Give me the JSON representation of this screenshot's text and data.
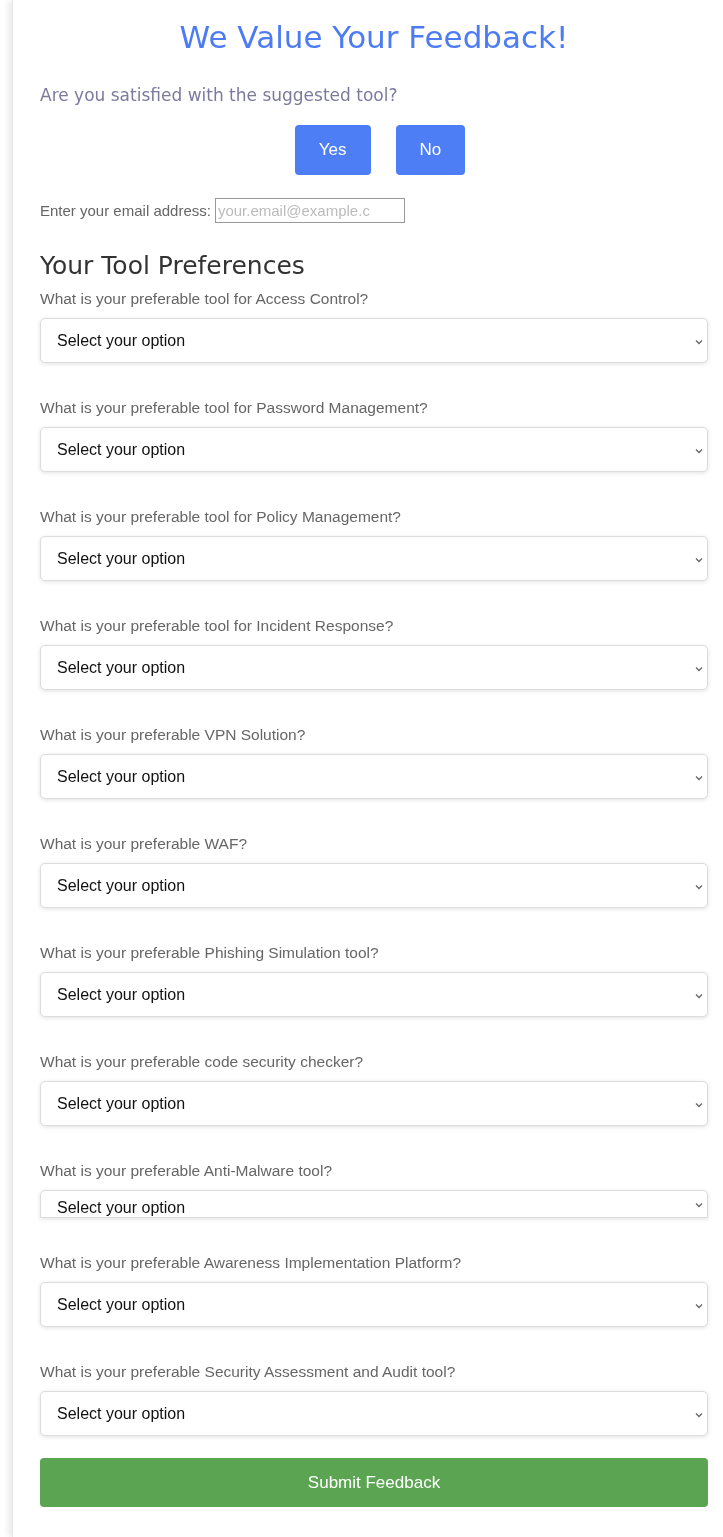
{
  "title": "We Value Your Feedback!",
  "satisfaction": {
    "question": "Are you satisfied with the suggested tool?",
    "buttons": [
      "Yes",
      "No"
    ]
  },
  "email": {
    "label": "Enter your email address:",
    "placeholder": "your.email@example.c"
  },
  "preferences": {
    "heading": "Your Tool Preferences",
    "questions": [
      {
        "label": "What is your preferable tool for Access Control?",
        "value": "Select your option",
        "clipped": false
      },
      {
        "label": "What is your preferable tool for Password Management?",
        "value": "Select your option",
        "clipped": false
      },
      {
        "label": "What is your preferable tool for Policy Management?",
        "value": "Select your option",
        "clipped": false
      },
      {
        "label": "What is your preferable tool for Incident Response?",
        "value": "Select your option",
        "clipped": false
      },
      {
        "label": "What is your preferable VPN Solution?",
        "value": "Select your option",
        "clipped": false
      },
      {
        "label": "What is your preferable WAF?",
        "value": "Select your option",
        "clipped": false
      },
      {
        "label": "What is your preferable Phishing Simulation tool?",
        "value": "Select your option",
        "clipped": false
      },
      {
        "label": "What is your preferable code security checker?",
        "value": "Select your option",
        "clipped": false
      },
      {
        "label": "What is your preferable Anti-Malware tool?",
        "value": "Select your option",
        "clipped": true
      },
      {
        "label": "What is your preferable Awareness Implementation Platform?",
        "value": "Select your option",
        "clipped": false
      },
      {
        "label": "What is your preferable Security Assessment and Audit tool?",
        "value": "Select your option",
        "clipped": false
      }
    ]
  },
  "submit": "Submit Feedback"
}
